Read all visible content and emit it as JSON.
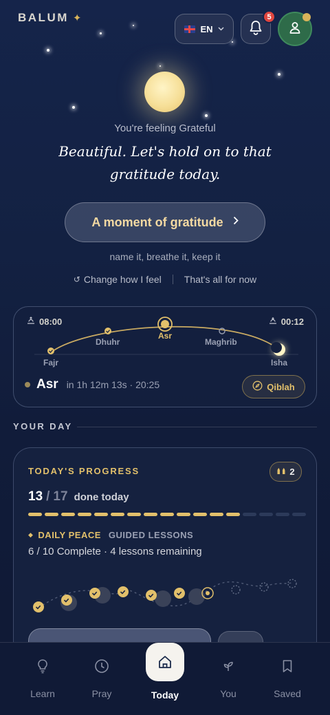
{
  "header": {
    "brand": "BALUM",
    "language": "EN",
    "notification_count": "5"
  },
  "hero": {
    "feeling_text": "You're feeling Grateful",
    "quote": "Beautiful. Let's hold on to that gratitude today.",
    "cta_label": "A moment of gratitude",
    "cta_subtitle": "name it, breathe it, keep it",
    "change_feeling": "Change how I feel",
    "done_for_now": "That's all for now"
  },
  "prayer": {
    "sunrise_time": "08:00",
    "night_time": "00:12",
    "prayers": [
      "Fajr",
      "Dhuhr",
      "Asr",
      "Maghrib",
      "Isha"
    ],
    "current_prayer": "Asr",
    "current_info": "in 1h 12m 13s · 20:25",
    "qiblah_label": "Qiblah"
  },
  "your_day": {
    "section_title": "YOUR DAY",
    "progress_title": "TODAY'S PROGRESS",
    "streak_count": "2",
    "done": "13",
    "total": "17",
    "done_label": "done today",
    "segments_done": 13,
    "segments_total": 17,
    "track_name": "DAILY PEACE",
    "track_type": "GUIDED LESSONS",
    "lessons_info": "6 / 10 Complete · 4 lessons remaining",
    "lessons_completed": 6,
    "lessons_total": 10
  },
  "nav": {
    "items": [
      {
        "label": "Learn",
        "icon": "lightbulb-icon"
      },
      {
        "label": "Pray",
        "icon": "clock-icon"
      },
      {
        "label": "Today",
        "icon": "home-icon"
      },
      {
        "label": "You",
        "icon": "sprout-icon"
      },
      {
        "label": "Saved",
        "icon": "bookmark-icon"
      }
    ],
    "active": "Today"
  },
  "colors": {
    "accent_gold": "#e2c06b",
    "background": "#132142",
    "avatar_green": "#2e6b49",
    "badge_red": "#e0463f"
  }
}
